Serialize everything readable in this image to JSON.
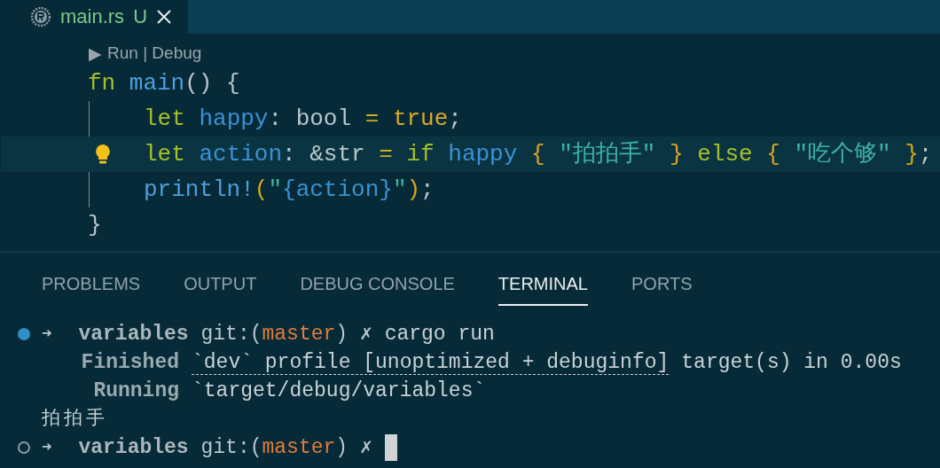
{
  "editor_tab": {
    "label": "main.rs",
    "status": "U",
    "selected": true
  },
  "code_lens": {
    "icon": "▶",
    "text": "Run | Debug"
  },
  "code": [
    {
      "tokens": [
        {
          "kind": "kw",
          "text": "fn "
        },
        {
          "kind": "fn",
          "text": "main"
        },
        {
          "kind": "p",
          "text": "() {"
        }
      ],
      "children": [
        {
          "tokens": [
            {
              "kind": "kw",
              "text": "let "
            },
            {
              "kind": "var",
              "text": "happy"
            },
            {
              "kind": "p",
              "text": ": bool "
            },
            {
              "kind": "op",
              "text": "= "
            },
            {
              "kind": "lit",
              "text": "true"
            },
            {
              "kind": "p",
              "text": ";"
            }
          ],
          "current": false,
          "lightbulb": false
        },
        {
          "tokens": [
            {
              "kind": "kw",
              "text": "let "
            },
            {
              "kind": "var",
              "text": "action"
            },
            {
              "kind": "p",
              "text": ": &str "
            },
            {
              "kind": "op",
              "text": "= "
            },
            {
              "kind": "kw",
              "text": "if "
            },
            {
              "kind": "var",
              "text": "happy "
            },
            {
              "kind": "br",
              "text": "{ "
            },
            {
              "kind": "str",
              "text": "\"拍拍手\" "
            },
            {
              "kind": "br",
              "text": "} "
            },
            {
              "kind": "kw",
              "text": "else "
            },
            {
              "kind": "br",
              "text": "{ "
            },
            {
              "kind": "str",
              "text": "\"吃个够\" "
            },
            {
              "kind": "br",
              "text": "}"
            },
            {
              "kind": "p",
              "text": ";"
            }
          ],
          "current": true,
          "lightbulb": true
        },
        {
          "tokens": [
            {
              "kind": "fn",
              "text": "println!"
            },
            {
              "kind": "br",
              "text": "("
            },
            {
              "kind": "str",
              "text": "\""
            },
            {
              "kind": "var",
              "text": "{action}"
            },
            {
              "kind": "str",
              "text": "\""
            },
            {
              "kind": "br",
              "text": ")"
            },
            {
              "kind": "p",
              "text": ";"
            }
          ],
          "current": false,
          "lightbulb": false
        }
      ]
    },
    {
      "tokens": [
        {
          "kind": "p",
          "text": "}"
        }
      ]
    }
  ],
  "panel_tabs": [
    {
      "label": "PROBLEMS",
      "selected": false
    },
    {
      "label": "OUTPUT",
      "selected": false
    },
    {
      "label": "DEBUG CONSOLE",
      "selected": false
    },
    {
      "label": "TERMINAL",
      "selected": true
    },
    {
      "label": "PORTS",
      "selected": false
    }
  ],
  "terminal": [
    {
      "kind": "prompt",
      "running": true,
      "arrow": "➜",
      "dir": "variables",
      "git": "git:(",
      "branch": "master",
      "close": ")",
      "mark": "✗",
      "command": "cargo run",
      "cursor": false
    },
    {
      "kind": "cargo",
      "label": "Finished",
      "link": "`dev` profile [unoptimized + debuginfo]",
      "text": "target(s) in 0.00s"
    },
    {
      "kind": "cargo",
      "label": "Running",
      "text": "`target/debug/variables`"
    },
    {
      "kind": "output",
      "text": "拍拍手"
    },
    {
      "kind": "prompt",
      "running": false,
      "arrow": "➜",
      "dir": "variables",
      "git": "git:(",
      "branch": "master",
      "close": ")",
      "mark": "✗",
      "cursor": true
    }
  ]
}
